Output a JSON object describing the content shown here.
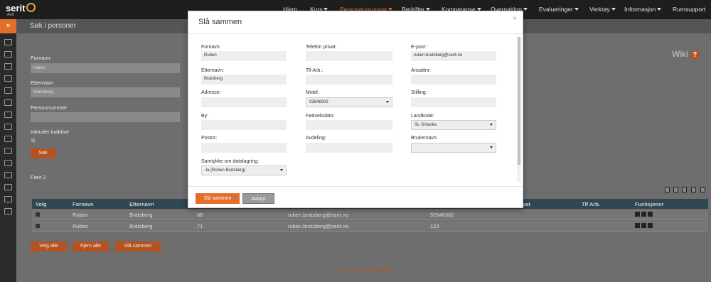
{
  "logo": {
    "brand": "serit",
    "sub": "Avdi"
  },
  "nav": [
    {
      "label": "Hjem",
      "caret": false
    },
    {
      "label": "Kurs",
      "caret": true
    },
    {
      "label": "Personer/grupper",
      "caret": true
    },
    {
      "label": "Bedrifter",
      "caret": true
    },
    {
      "label": "Kompetanse",
      "caret": true
    },
    {
      "label": "Overnatting",
      "caret": true
    },
    {
      "label": "Evalueringer",
      "caret": true
    },
    {
      "label": "Verktøy",
      "caret": true
    },
    {
      "label": "Informasjon",
      "caret": true
    },
    {
      "label": "Rumsupport",
      "caret": false
    }
  ],
  "page": {
    "title": "Søk i personer",
    "wiki": "Wiki",
    "wiki_icon": "?"
  },
  "search": {
    "fornavn_label": "Fornavn",
    "fornavn_value": "ruben",
    "etternavn_label": "Etternavn",
    "etternavn_value": "bratsberg",
    "personnummer_label": "Personnummer",
    "personnummer_value": "",
    "inaktive_label": "Inkluder inaktive",
    "sok_button": "Søk"
  },
  "results": {
    "count_label": "Fant 2"
  },
  "table": {
    "headers": [
      "Velg",
      "Fornavn",
      "Etternavn",
      "",
      "",
      "",
      "vat",
      "Tlf Arb.",
      "Funksjoner"
    ],
    "rows": [
      {
        "fornavn": "Ruben",
        "etternavn": "Bratsberg",
        "id": "68",
        "epost": "ruben.bratsberg@serit.no",
        "mobil": "92648302"
      },
      {
        "fornavn": "Ruben",
        "etternavn": "Bratsberg",
        "id": "71",
        "epost": "ruben.bratsberg@serit.no",
        "mobil": "123"
      }
    ]
  },
  "actions": {
    "velg_alle": "Velg alle",
    "fjern_alle": "Fjern alle",
    "sla_sammen": "Slå sammen"
  },
  "footer": "© 2018 Serit Kursadmin",
  "modal": {
    "title": "Slå sammen",
    "close": "×",
    "fields": {
      "fornavn_label": "Fornavn:",
      "fornavn_value": "Ruben",
      "telefon_privat_label": "Telefon privat:",
      "telefon_privat_value": "",
      "epost_label": "E-post:",
      "epost_value": "ruben.bratsberg@serit.no",
      "etternavn_label": "Etternavn:",
      "etternavn_value": "Bratsberg",
      "tlf_arb_label": "Tlf Arb.:",
      "tlf_arb_value": "",
      "ansattnr_label": "Ansattnr:",
      "ansattnr_value": "",
      "adresse_label": "Adresse:",
      "adresse_value": "",
      "mobil_label": "Mobil:",
      "mobil_value": "92648302",
      "stilling_label": "Stilling:",
      "stilling_value": "",
      "by_label": "By:",
      "by_value": "",
      "fodselsdato_label": "Fødselsdato:",
      "fodselsdato_value": "",
      "landkode_label": "Landkode:",
      "landkode_value": "SL-Srilanka",
      "postnr_label": "Postnr:",
      "postnr_value": "",
      "avdeling_label": "Avdeling:",
      "avdeling_value": "",
      "brukernavn_label": "Brukernavn:",
      "brukernavn_value": "",
      "samtykke_label": "Samtykke om datalagring:",
      "samtykke_value": "Ja (Ruben Bratsberg)"
    },
    "ok_button": "Slå sammen",
    "cancel_button": "Avbryt"
  },
  "colors": {
    "accent": "#e36e2c",
    "topbar": "#1e1e1e",
    "table_header": "#2f4653"
  }
}
